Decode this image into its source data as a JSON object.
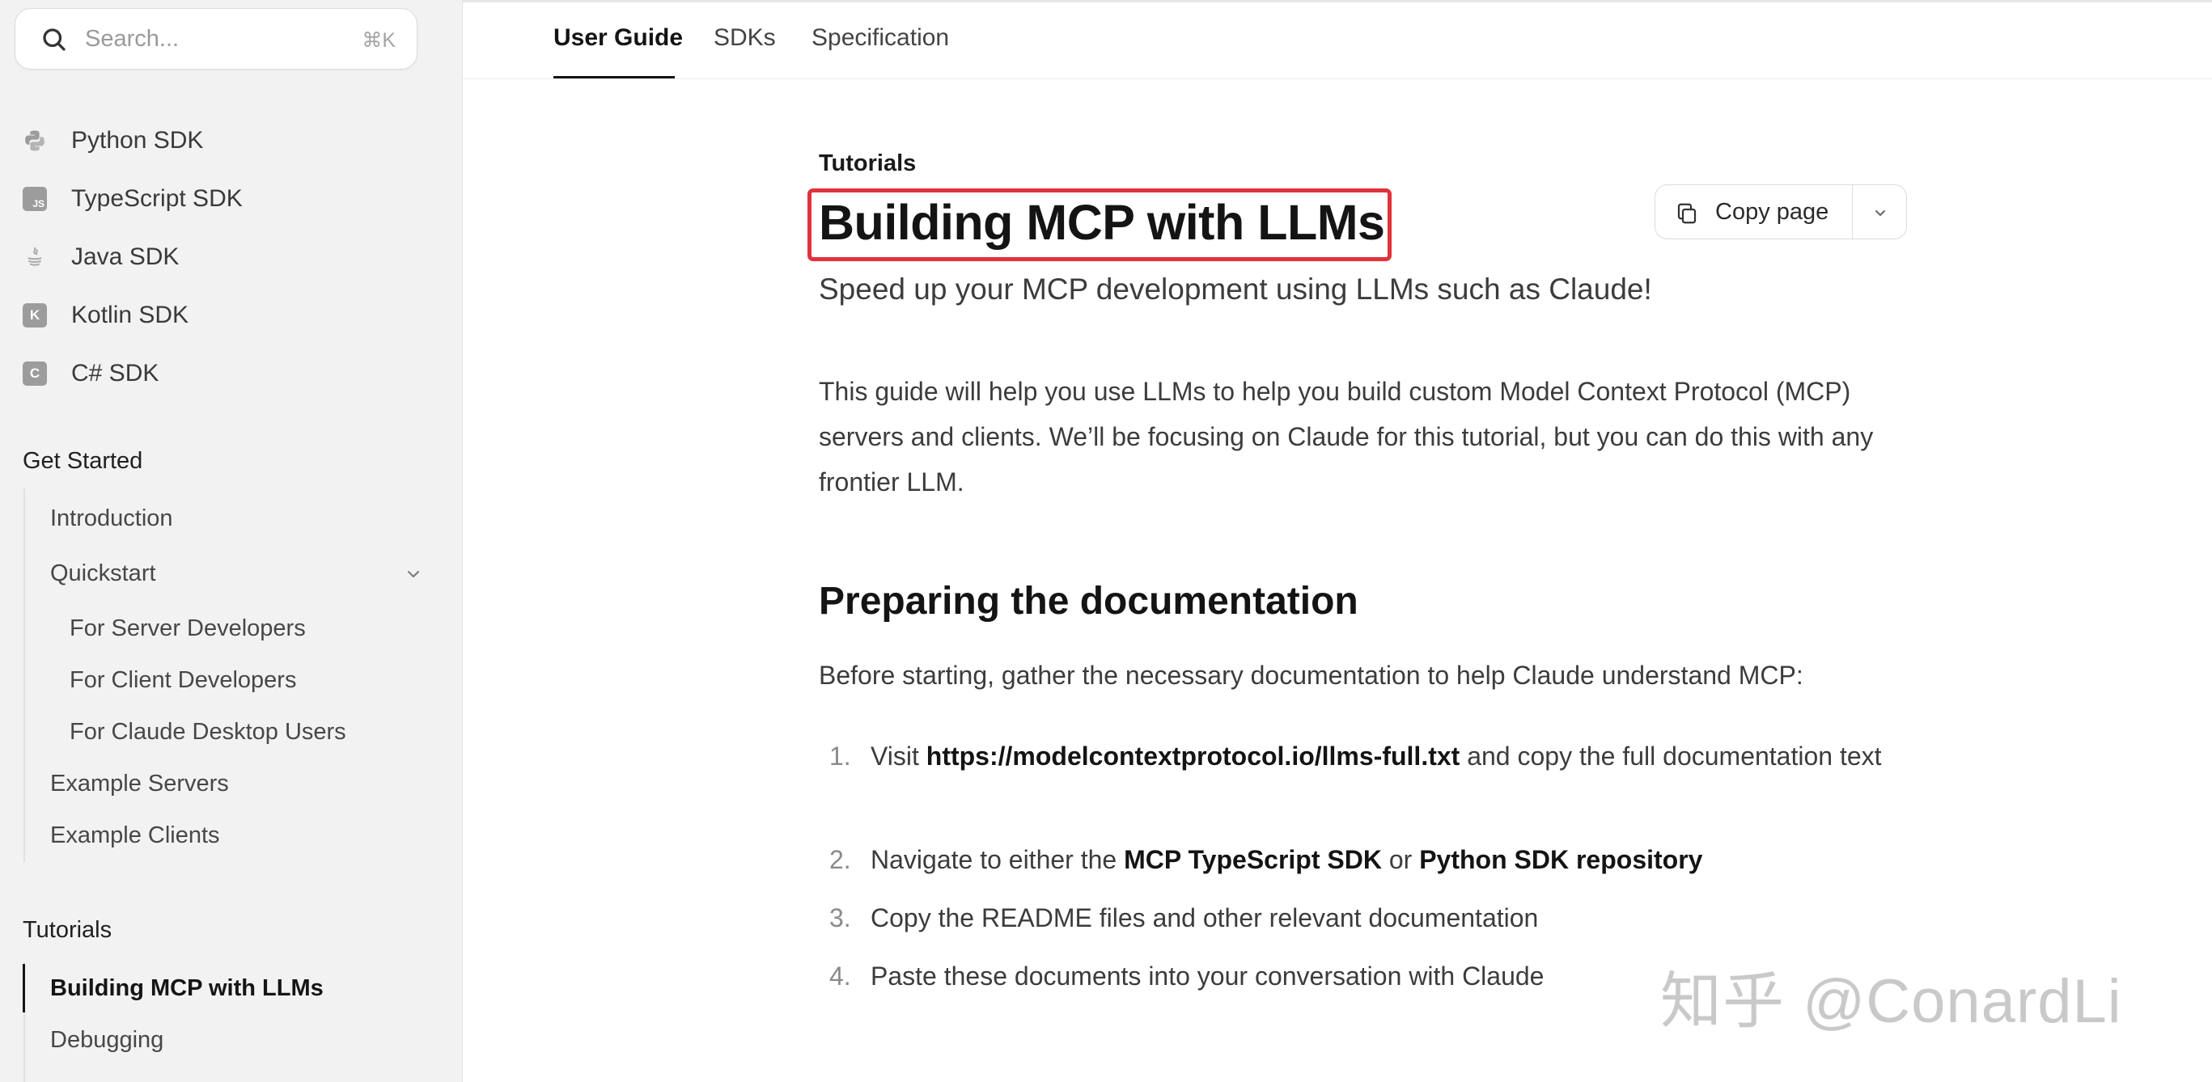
{
  "search": {
    "placeholder": "Search...",
    "shortcut": "⌘K"
  },
  "sdk_items": [
    {
      "label": "Python SDK",
      "icon": "python-icon"
    },
    {
      "label": "TypeScript SDK",
      "icon": "typescript-icon",
      "badge": "JS"
    },
    {
      "label": "Java SDK",
      "icon": "java-icon"
    },
    {
      "label": "Kotlin SDK",
      "icon": "kotlin-icon",
      "badge": "K"
    },
    {
      "label": "C# SDK",
      "icon": "csharp-icon",
      "badge": "C"
    }
  ],
  "get_started": {
    "title": "Get Started",
    "introduction": "Introduction",
    "quickstart": "Quickstart",
    "quickstart_children": [
      "For Server Developers",
      "For Client Developers",
      "For Claude Desktop Users"
    ],
    "example_servers": "Example Servers",
    "example_clients": "Example Clients"
  },
  "tutorials": {
    "title": "Tutorials",
    "items": [
      "Building MCP with LLMs",
      "Debugging"
    ],
    "active": "Building MCP with LLMs"
  },
  "tabs": [
    "User Guide",
    "SDKs",
    "Specification"
  ],
  "active_tab": "User Guide",
  "page": {
    "breadcrumb": "Tutorials",
    "title": "Building MCP with LLMs",
    "subtitle": "Speed up your MCP development using LLMs such as Claude!",
    "intro": "This guide will help you use LLMs to help you build custom Model Context Protocol (MCP) servers and clients. We’ll be focusing on Claude for this tutorial, but you can do this with any frontier LLM.",
    "section_title": "Preparing the documentation",
    "section_lead": "Before starting, gather the necessary documentation to help Claude understand MCP:",
    "steps": [
      {
        "num": "1.",
        "pre": "Visit ",
        "bold": "https://modelcontextprotocol.io/llms-full.txt",
        "post": " and copy the full documentation text"
      },
      {
        "num": "2.",
        "pre": "Navigate to either the ",
        "bold": "MCP TypeScript SDK",
        "mid": " or ",
        "bold2": "Python SDK repository",
        "post": ""
      },
      {
        "num": "3.",
        "pre": "Copy the README files and other relevant documentation"
      },
      {
        "num": "4.",
        "pre": "Paste these documents into your conversation with Claude"
      }
    ]
  },
  "copy_page": {
    "label": "Copy page"
  },
  "watermark": "知乎 @ConardLi",
  "colors": {
    "highlight": "#e0323b",
    "sidebar_bg": "#f2f2f2"
  }
}
